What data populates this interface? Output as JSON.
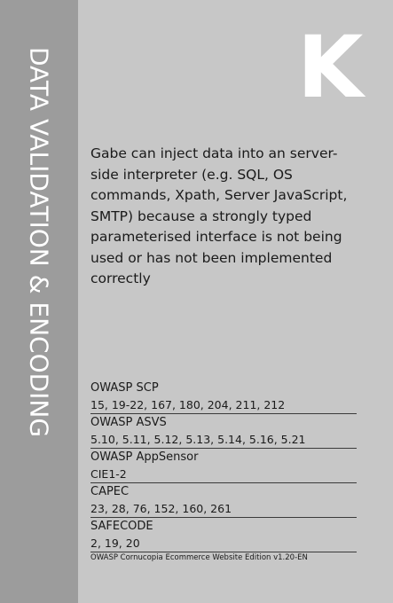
{
  "card": {
    "category": "DATA VALIDATION & ENCODING",
    "letter": "K",
    "description": "Gabe can inject data into an server-side interpreter (e.g. SQL, OS commands, Xpath, Server JavaScript, SMTP) because a strongly typed parameterised interface is not being used or has not been implemented correctly",
    "references": [
      {
        "name": "OWASP SCP",
        "values": "15, 19-22, 167, 180, 204, 211, 212"
      },
      {
        "name": "OWASP ASVS",
        "values": "5.10, 5.11, 5.12, 5.13, 5.14, 5.16, 5.21"
      },
      {
        "name": "OWASP AppSensor",
        "values": "CIE1-2"
      },
      {
        "name": "CAPEC",
        "values": "23, 28, 76, 152, 160, 261"
      },
      {
        "name": "SAFECODE",
        "values": "2, 19, 20"
      }
    ],
    "footer": "OWASP Cornucopia Ecommerce Website Edition v1.20-EN"
  },
  "colors": {
    "background": "#c7c7c7",
    "side_band": "#9c9c9c",
    "letter": "#ffffff",
    "text": "#1a1a1a"
  }
}
